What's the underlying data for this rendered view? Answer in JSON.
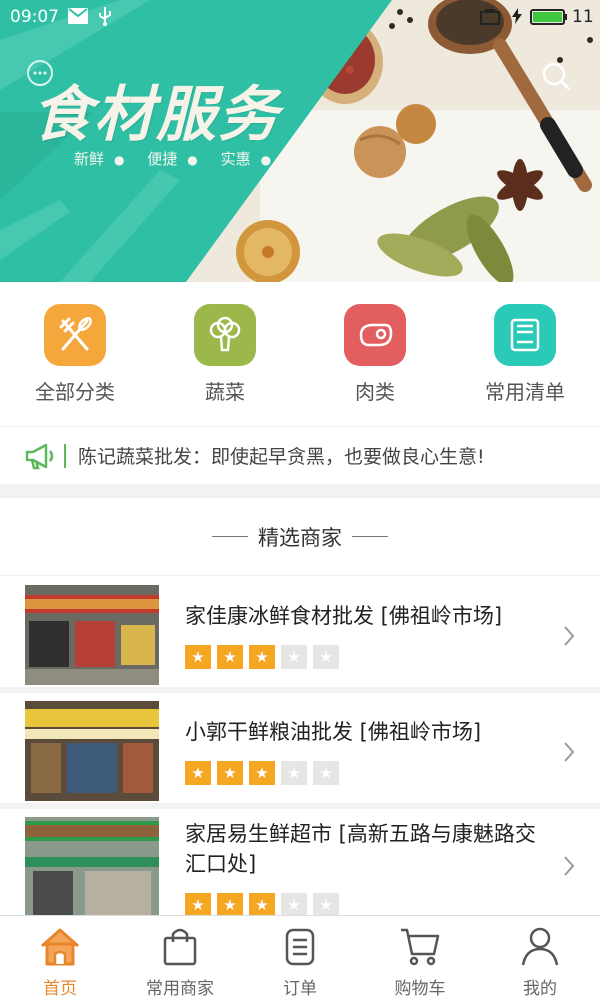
{
  "status_bar": {
    "time": "09:07",
    "battery_level": "11"
  },
  "banner": {
    "title": "食材服务",
    "subtitle_items": [
      "新鲜",
      "便捷",
      "实惠"
    ]
  },
  "categories": [
    {
      "label": "全部分类",
      "icon": "utensils-icon",
      "color": "#f6a73c"
    },
    {
      "label": "蔬菜",
      "icon": "broccoli-icon",
      "color": "#9cb84a"
    },
    {
      "label": "肉类",
      "icon": "meat-icon",
      "color": "#e35f5f"
    },
    {
      "label": "常用清单",
      "icon": "list-icon",
      "color": "#2bc9b8"
    }
  ],
  "notice": {
    "text": "陈记蔬菜批发：即使起早贪黑，也要做良心生意!"
  },
  "section": {
    "title": "精选商家"
  },
  "shops": [
    {
      "name": "家佳康冰鲜食材批发 [佛祖岭市场]",
      "rating": 3,
      "max_rating": 5
    },
    {
      "name": "小郭干鲜粮油批发 [佛祖岭市场]",
      "rating": 3,
      "max_rating": 5
    },
    {
      "name": "家居易生鲜超市 [高新五路与康魅路交汇口处]",
      "rating": 3,
      "max_rating": 5
    }
  ],
  "tabbar": {
    "items": [
      {
        "label": "首页",
        "icon": "home-icon",
        "active": true
      },
      {
        "label": "常用商家",
        "icon": "shopping-bag-icon",
        "active": false
      },
      {
        "label": "订单",
        "icon": "order-icon",
        "active": false
      },
      {
        "label": "购物车",
        "icon": "cart-icon",
        "active": false
      },
      {
        "label": "我的",
        "icon": "user-icon",
        "active": false
      }
    ]
  },
  "colors": {
    "accent": "#e8862b",
    "teal": "#2fbfa5",
    "star": "#f5a623"
  }
}
